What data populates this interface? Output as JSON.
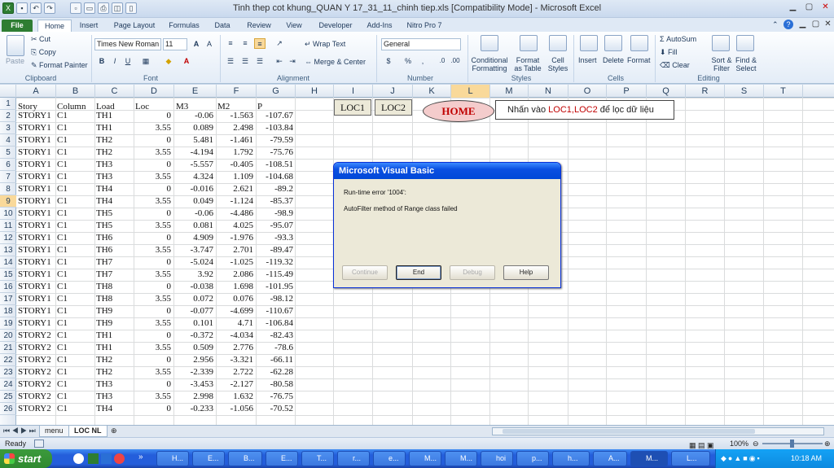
{
  "window": {
    "title": "Tinh thep cot khung_QUAN Y 17_31_11_chinh tiep.xls  [Compatibility Mode]  -  Microsoft Excel"
  },
  "ribbon": {
    "tabs": [
      "File",
      "Home",
      "Insert",
      "Page Layout",
      "Formulas",
      "Data",
      "Review",
      "View",
      "Developer",
      "Add-Ins",
      "Nitro Pro 7"
    ],
    "clipboard": {
      "group": "Clipboard",
      "paste": "Paste",
      "cut": "Cut",
      "copy": "Copy",
      "format_painter": "Format Painter"
    },
    "font": {
      "group": "Font",
      "name": "Times New Roman",
      "size": "11"
    },
    "alignment": {
      "group": "Alignment",
      "wrap": "Wrap Text",
      "merge": "Merge & Center"
    },
    "number": {
      "group": "Number",
      "format": "General",
      "currency": "$",
      "percent": "%",
      "comma": ","
    },
    "styles": {
      "group": "Styles",
      "conditional": "Conditional\nFormatting",
      "format_table": "Format\nas Table",
      "cell_styles": "Cell\nStyles"
    },
    "cells": {
      "group": "Cells",
      "insert": "Insert",
      "delete": "Delete",
      "format": "Format"
    },
    "editing": {
      "group": "Editing",
      "autosum": "AutoSum",
      "fill": "Fill",
      "clear": "Clear",
      "sort": "Sort &\nFilter",
      "find": "Find &\nSelect"
    }
  },
  "columns": [
    "A",
    "B",
    "C",
    "D",
    "E",
    "F",
    "G",
    "H",
    "I",
    "J",
    "K",
    "L",
    "M",
    "N",
    "O",
    "P",
    "Q",
    "R",
    "S",
    "T"
  ],
  "rows": [
    [
      "Story",
      "Column",
      "Load",
      "Loc",
      "M3",
      "M2",
      "P"
    ],
    [
      "STORY1",
      "C1",
      "TH1",
      "0",
      "-0.06",
      "-1.563",
      "-107.67"
    ],
    [
      "STORY1",
      "C1",
      "TH1",
      "3.55",
      "0.089",
      "2.498",
      "-103.84"
    ],
    [
      "STORY1",
      "C1",
      "TH2",
      "0",
      "5.481",
      "-1.461",
      "-79.59"
    ],
    [
      "STORY1",
      "C1",
      "TH2",
      "3.55",
      "-4.194",
      "1.792",
      "-75.76"
    ],
    [
      "STORY1",
      "C1",
      "TH3",
      "0",
      "-5.557",
      "-0.405",
      "-108.51"
    ],
    [
      "STORY1",
      "C1",
      "TH3",
      "3.55",
      "4.324",
      "1.109",
      "-104.68"
    ],
    [
      "STORY1",
      "C1",
      "TH4",
      "0",
      "-0.016",
      "2.621",
      "-89.2"
    ],
    [
      "STORY1",
      "C1",
      "TH4",
      "3.55",
      "0.049",
      "-1.124",
      "-85.37"
    ],
    [
      "STORY1",
      "C1",
      "TH5",
      "0",
      "-0.06",
      "-4.486",
      "-98.9"
    ],
    [
      "STORY1",
      "C1",
      "TH5",
      "3.55",
      "0.081",
      "4.025",
      "-95.07"
    ],
    [
      "STORY1",
      "C1",
      "TH6",
      "0",
      "4.909",
      "-1.976",
      "-93.3"
    ],
    [
      "STORY1",
      "C1",
      "TH6",
      "3.55",
      "-3.747",
      "2.701",
      "-89.47"
    ],
    [
      "STORY1",
      "C1",
      "TH7",
      "0",
      "-5.024",
      "-1.025",
      "-119.32"
    ],
    [
      "STORY1",
      "C1",
      "TH7",
      "3.55",
      "3.92",
      "2.086",
      "-115.49"
    ],
    [
      "STORY1",
      "C1",
      "TH8",
      "0",
      "-0.038",
      "1.698",
      "-101.95"
    ],
    [
      "STORY1",
      "C1",
      "TH8",
      "3.55",
      "0.072",
      "0.076",
      "-98.12"
    ],
    [
      "STORY1",
      "C1",
      "TH9",
      "0",
      "-0.077",
      "-4.699",
      "-110.67"
    ],
    [
      "STORY1",
      "C1",
      "TH9",
      "3.55",
      "0.101",
      "4.71",
      "-106.84"
    ],
    [
      "STORY2",
      "C1",
      "TH1",
      "0",
      "-0.372",
      "-4.034",
      "-82.43"
    ],
    [
      "STORY2",
      "C1",
      "TH1",
      "3.55",
      "0.509",
      "2.776",
      "-78.6"
    ],
    [
      "STORY2",
      "C1",
      "TH2",
      "0",
      "2.956",
      "-3.321",
      "-66.11"
    ],
    [
      "STORY2",
      "C1",
      "TH2",
      "3.55",
      "-2.339",
      "2.722",
      "-62.28"
    ],
    [
      "STORY2",
      "C1",
      "TH3",
      "0",
      "-3.453",
      "-2.127",
      "-80.58"
    ],
    [
      "STORY2",
      "C1",
      "TH3",
      "3.55",
      "2.998",
      "1.632",
      "-76.75"
    ],
    [
      "STORY2",
      "C1",
      "TH4",
      "0",
      "-0.233",
      "-1.056",
      "-70.52"
    ]
  ],
  "sheet_buttons": {
    "loc1": "LOC1",
    "loc2": "LOC2",
    "home": "HOME",
    "note_prefix": "Nhấn vào ",
    "note_highlight": "LOC1,LOC2",
    "note_suffix": " để lọc dữ liệu"
  },
  "dialog": {
    "title": "Microsoft Visual Basic",
    "error": "Run-time error '1004':",
    "message": "AutoFilter method of Range class failed",
    "buttons": [
      "Continue",
      "End",
      "Debug",
      "Help"
    ]
  },
  "sheets": [
    "menu",
    "LOC NL"
  ],
  "status": {
    "ready": "Ready",
    "zoom": "100%"
  },
  "taskbar": {
    "start": "start",
    "buttons": [
      "H...",
      "E...",
      "B...",
      "E...",
      "T...",
      "r...",
      "e...",
      "M...",
      "M...",
      "hoi",
      "p...",
      "h...",
      "A...",
      "M...",
      "L..."
    ],
    "clock": "10:18 AM"
  },
  "colors": {
    "accent_red": "#c00000",
    "selection": "#f9d99a",
    "excel_green": "#2e7d32"
  }
}
